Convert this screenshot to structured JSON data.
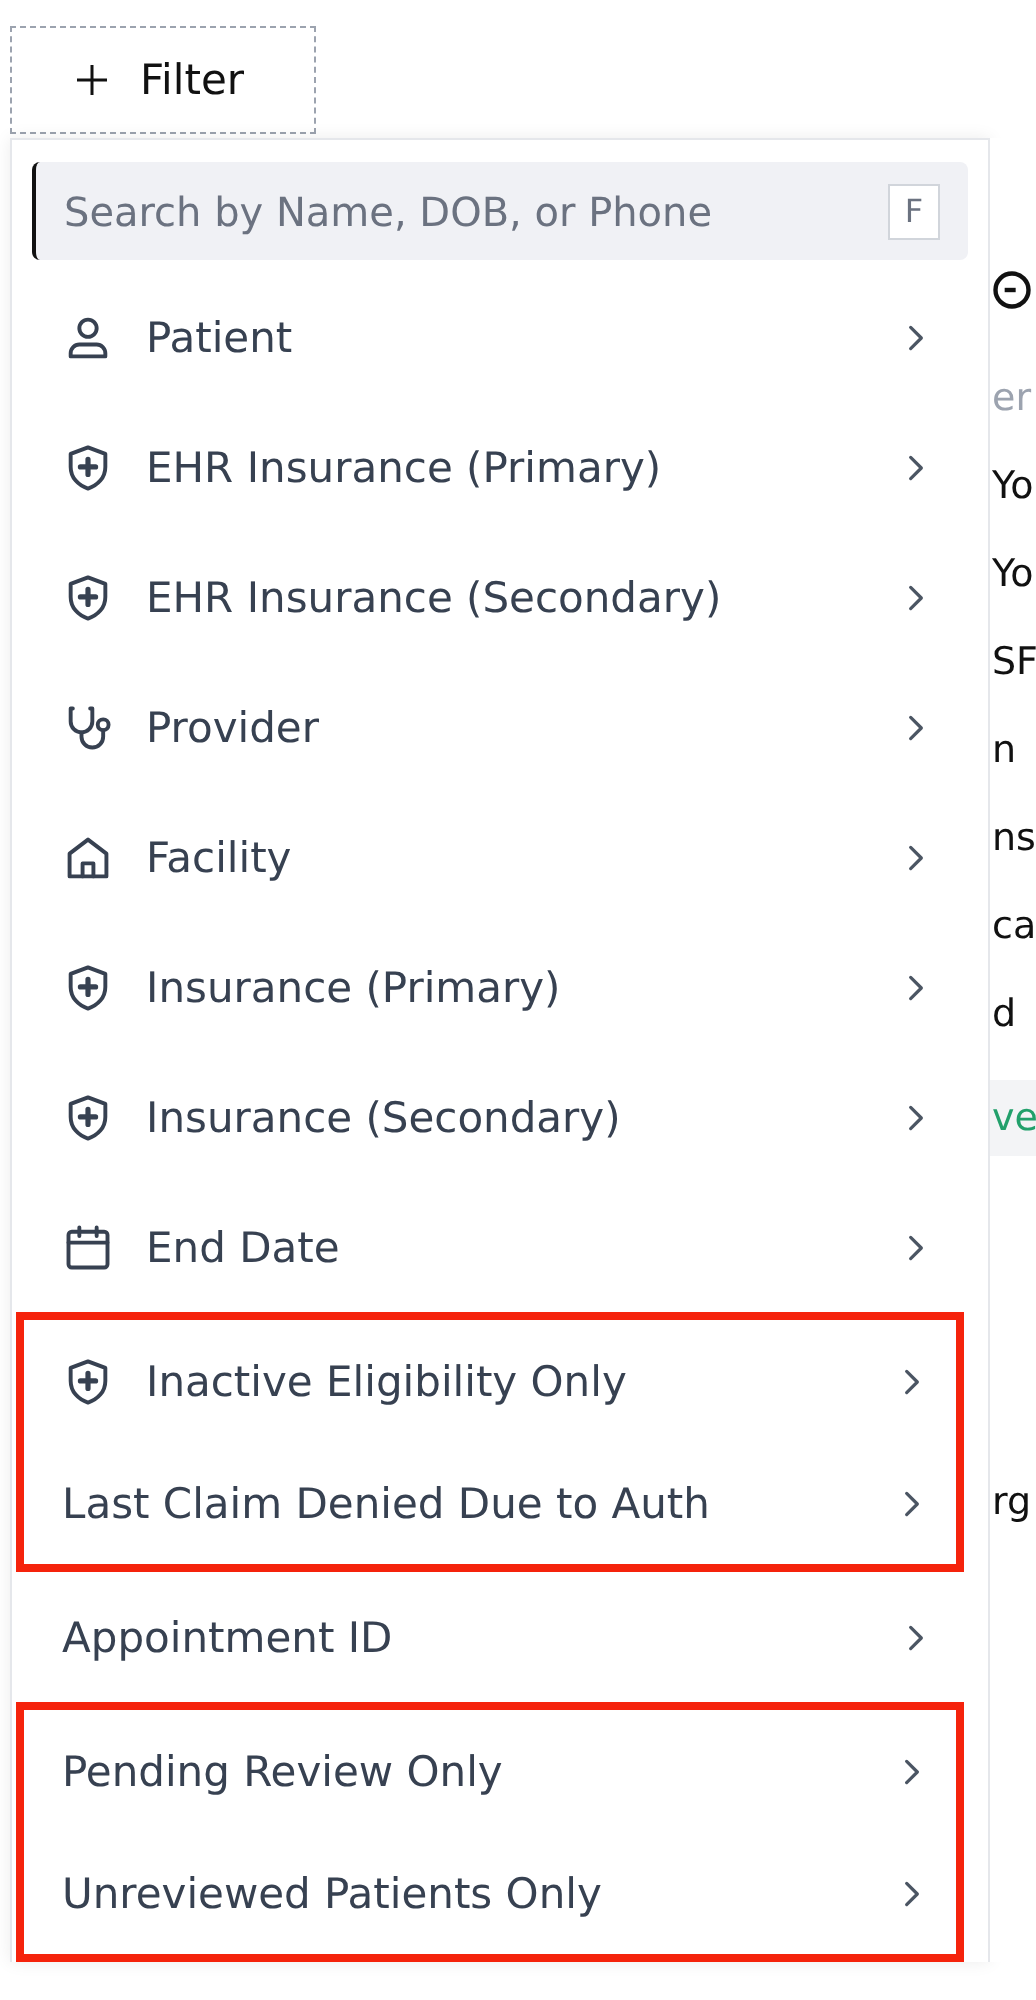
{
  "filter_button": {
    "label": "Filter"
  },
  "menu": {
    "search": {
      "placeholder": "Search by Name, DOB, or Phone",
      "shortcut": "F"
    },
    "groups": [
      {
        "highlighted": false,
        "items": [
          {
            "kind": "person",
            "label": "Patient"
          },
          {
            "kind": "shield",
            "label": "EHR Insurance (Primary)"
          },
          {
            "kind": "shield",
            "label": "EHR Insurance (Secondary)"
          },
          {
            "kind": "stethoscope",
            "label": "Provider"
          },
          {
            "kind": "building",
            "label": "Facility"
          },
          {
            "kind": "shield",
            "label": "Insurance (Primary)"
          },
          {
            "kind": "shield",
            "label": "Insurance (Secondary)"
          },
          {
            "kind": "calendar",
            "label": "End Date"
          }
        ]
      },
      {
        "highlighted": true,
        "items": [
          {
            "kind": "shield",
            "label": "Inactive Eligibility Only"
          },
          {
            "kind": "plain",
            "label": "Last Claim Denied Due to Auth"
          }
        ]
      },
      {
        "highlighted": false,
        "items": [
          {
            "kind": "plain",
            "label": "Appointment ID"
          }
        ]
      },
      {
        "highlighted": true,
        "items": [
          {
            "kind": "plain",
            "label": "Pending Review Only"
          },
          {
            "kind": "plain",
            "label": "Unreviewed Patients Only"
          }
        ]
      }
    ]
  },
  "background_page": {
    "fragments": [
      {
        "kind": "label",
        "text": "er"
      },
      {
        "kind": "value",
        "text": "Yo"
      },
      {
        "kind": "value",
        "text": "Yo"
      },
      {
        "kind": "value",
        "text": "SF"
      },
      {
        "kind": "value",
        "text": "n"
      },
      {
        "kind": "value",
        "text": "ns"
      },
      {
        "kind": "value",
        "text": "ca"
      },
      {
        "kind": "value",
        "text": "d"
      },
      {
        "kind": "status",
        "text": "ve"
      },
      {
        "kind": "heading",
        "text": "rg"
      }
    ]
  }
}
